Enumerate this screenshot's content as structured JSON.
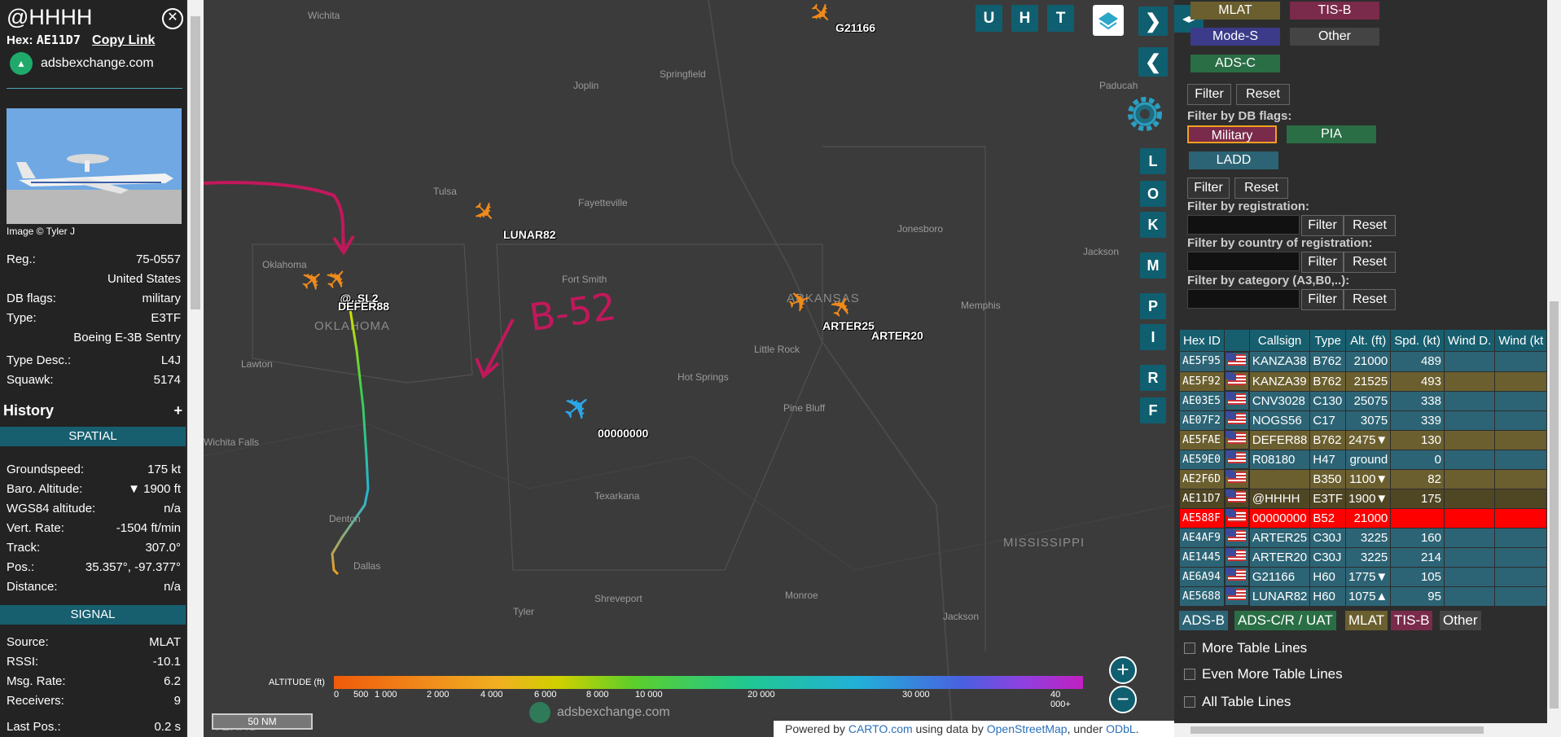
{
  "sidebar": {
    "callsign": "@HHHH",
    "hex_label": "Hex:",
    "hex_value": "AE11D7",
    "copy_link": "Copy Link",
    "source_site": "adsbexchange.com",
    "photo_credit": "Image © Tyler J",
    "details": [
      {
        "label": "Reg.:",
        "value": "75-0557"
      },
      {
        "label": "",
        "value": "United States"
      },
      {
        "label": "DB flags:",
        "value": "military"
      },
      {
        "label": "Type:",
        "value": "E3TF"
      },
      {
        "label": "",
        "value": "Boeing E-3B Sentry"
      },
      {
        "label": "Type Desc.:",
        "value": "L4J"
      },
      {
        "label": "Squawk:",
        "value": "5174"
      }
    ],
    "history_title": "History",
    "history_plus": "+",
    "spatial_title": "SPATIAL",
    "spatial": [
      {
        "label": "Groundspeed:",
        "value": "175 kt"
      },
      {
        "label": "Baro. Altitude:",
        "value": "▼ 1900 ft"
      },
      {
        "label": "WGS84 altitude:",
        "value": "n/a"
      },
      {
        "label": "Vert. Rate:",
        "value": "-1504 ft/min"
      },
      {
        "label": "Track:",
        "value": "307.0°"
      },
      {
        "label": "Pos.:",
        "value": "35.357°, -97.377°"
      },
      {
        "label": "Distance:",
        "value": "n/a"
      }
    ],
    "signal_title": "SIGNAL",
    "signal": [
      {
        "label": "Source:",
        "value": "MLAT"
      },
      {
        "label": "RSSI:",
        "value": "-10.1"
      },
      {
        "label": "Msg. Rate:",
        "value": "6.2"
      },
      {
        "label": "Receivers:",
        "value": "9"
      },
      {
        "label": "Last Pos.:",
        "value": "0.2 s"
      }
    ]
  },
  "map": {
    "places": [
      "Wichita",
      "Springfield",
      "Joplin",
      "Paducah",
      "Tulsa",
      "Fayetteville",
      "Jonesboro",
      "Jackson",
      "Fort Smith",
      "Memphis",
      "Little Rock",
      "Hot Springs",
      "Pine Bluff",
      "Lawton",
      "Dallas",
      "Texarkana",
      "Shreveport",
      "Monroe",
      "Tyler",
      "Denton",
      "Jackson",
      "Wichita Falls",
      "Oklahoma"
    ],
    "states": [
      "OKLAHOMA",
      "ARKANSAS",
      "MISSISSIPPI",
      "TEXAS"
    ],
    "aircraft_labels": [
      "G21166",
      "LUNAR82",
      "DEFER88",
      "ARTER25",
      "ARTER20",
      "00000000"
    ],
    "overlap_label": "     @..SL2",
    "annotation": "B-52",
    "top_buttons": [
      "U",
      "H",
      "T"
    ],
    "side_buttons": [
      "L",
      "O",
      "K",
      "M",
      "P",
      "I",
      "R",
      "F"
    ],
    "altitude_title": "ALTITUDE (ft)",
    "altitude_ticks": [
      "0",
      "500",
      "1 000",
      "2 000",
      "4 000",
      "6 000",
      "8 000",
      "10 000",
      "20 000",
      "30 000",
      "40 000+"
    ],
    "scale": "50 NM",
    "watermark": "adsbexchange.com",
    "attribution": {
      "prefix": "Powered by ",
      "carto": "CARTO.com",
      "mid": " using data by ",
      "osm": "OpenStreetMap",
      "under": ", under ",
      "odbl": "ODbL",
      "end": "."
    },
    "colors": {
      "arrow": "#c2185b",
      "selected_plane": "#f08a1a",
      "b52_plane": "#2aa6e6"
    }
  },
  "filters": {
    "source_chips": [
      "MLAT",
      "TIS-B",
      "Mode-S",
      "Other",
      "ADS-C"
    ],
    "filter_btn": "Filter",
    "reset_btn": "Reset",
    "db_flags_title": "Filter by DB flags:",
    "db_flags": [
      "Military",
      "PIA",
      "LADD"
    ],
    "registration_title": "Filter by registration:",
    "country_title": "Filter by country of registration:",
    "category_title": "Filter by category (A3,B0,..):"
  },
  "table": {
    "headers": [
      "Hex ID",
      "",
      "Callsign",
      "Type",
      "Alt. (ft)",
      "Spd. (kt)",
      "Wind D.",
      "Wind (kt"
    ],
    "rows": [
      {
        "hex": "AE5F95",
        "callsign": "KANZA38",
        "type": "B762",
        "alt": "21000",
        "spd": "489",
        "style": "blue"
      },
      {
        "hex": "AE5F92",
        "callsign": "KANZA39",
        "type": "B762",
        "alt": "21525",
        "spd": "493",
        "style": "olive"
      },
      {
        "hex": "AE03E5",
        "callsign": "CNV3028",
        "type": "C130",
        "alt": "25075",
        "spd": "338",
        "style": "blue"
      },
      {
        "hex": "AE07F2",
        "callsign": "NOGS56",
        "type": "C17",
        "alt": "3075",
        "spd": "339",
        "style": "blue"
      },
      {
        "hex": "AE5FAE",
        "callsign": "DEFER88",
        "type": "B762",
        "alt": "2475▼",
        "spd": "130",
        "style": "olive"
      },
      {
        "hex": "AE59E0",
        "callsign": "R08180",
        "type": "H47",
        "alt": "ground",
        "spd": "0",
        "style": "blue"
      },
      {
        "hex": "AE2F6D",
        "callsign": "",
        "type": "B350",
        "alt": "1100▼",
        "spd": "82",
        "style": "olive"
      },
      {
        "hex": "AE11D7",
        "callsign": "@HHHH",
        "type": "E3TF",
        "alt": "1900▼",
        "spd": "175",
        "style": "sel"
      },
      {
        "hex": "AE588F",
        "callsign": "00000000",
        "type": "B52",
        "alt": "21000",
        "spd": "",
        "style": "red"
      },
      {
        "hex": "AE4AF9",
        "callsign": "ARTER25",
        "type": "C30J",
        "alt": "3225",
        "spd": "160",
        "style": "blue"
      },
      {
        "hex": "AE1445",
        "callsign": "ARTER20",
        "type": "C30J",
        "alt": "3225",
        "spd": "214",
        "style": "blue"
      },
      {
        "hex": "AE6A94",
        "callsign": "G21166",
        "type": "H60",
        "alt": "1775▼",
        "spd": "105",
        "style": "blue"
      },
      {
        "hex": "AE5688",
        "callsign": "LUNAR82",
        "type": "H60",
        "alt": "1075▲",
        "spd": "95",
        "style": "blue"
      }
    ]
  },
  "legend": [
    "ADS-B",
    "ADS-C/R / UAT",
    "MLAT",
    "TIS-B",
    "Other"
  ],
  "options": [
    "More Table Lines",
    "Even More Table Lines",
    "All Table Lines"
  ]
}
